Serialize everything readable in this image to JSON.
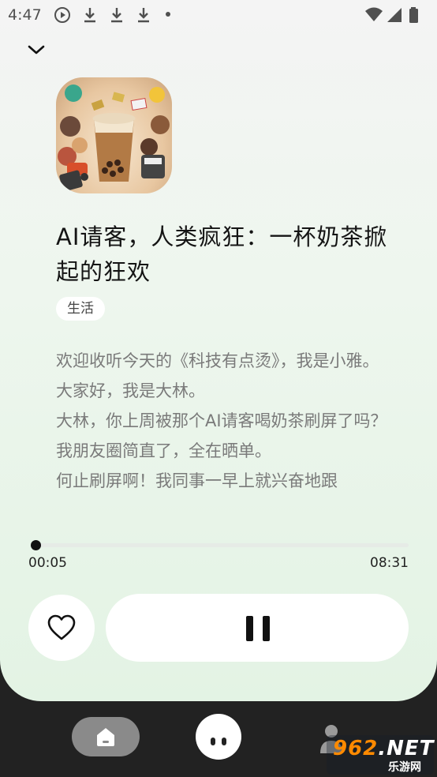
{
  "status_bar": {
    "time": "4:47",
    "icons": [
      "play-circle-icon",
      "download-icon",
      "download-icon",
      "download-icon",
      "dot-icon"
    ],
    "right_icons": [
      "wifi-icon",
      "signal-icon",
      "battery-icon"
    ]
  },
  "player": {
    "collapse_icon": "chevron-down-icon",
    "title": "AI请客，人类疯狂：一杯奶茶掀起的狂欢",
    "tag": "生活",
    "transcript": [
      "欢迎收听今天的《科技有点烫》，我是小雅。",
      "大家好，我是大林。",
      "大林，你上周被那个AI请客喝奶茶刷屏了吗？我朋友圈简直了，全在晒单。",
      "何止刷屏啊！我同事一早上就兴奋地跟"
    ],
    "progress": {
      "current": "00:05",
      "total": "08:31",
      "fraction": 0.01
    },
    "like_icon": "heart-outline-icon",
    "play_state_icon": "pause-icon"
  },
  "bottom_nav": {
    "items": [
      "home-icon",
      "mascot-icon",
      "profile-icon"
    ]
  },
  "watermark": {
    "brand_digits": "962",
    "brand_suffix": ".NET",
    "subtitle": "乐游网"
  },
  "colors": {
    "background_top": "#f4f4f4",
    "background_bottom": "#e3f3e4",
    "nav_bar": "#222222",
    "accent": "#111111"
  }
}
